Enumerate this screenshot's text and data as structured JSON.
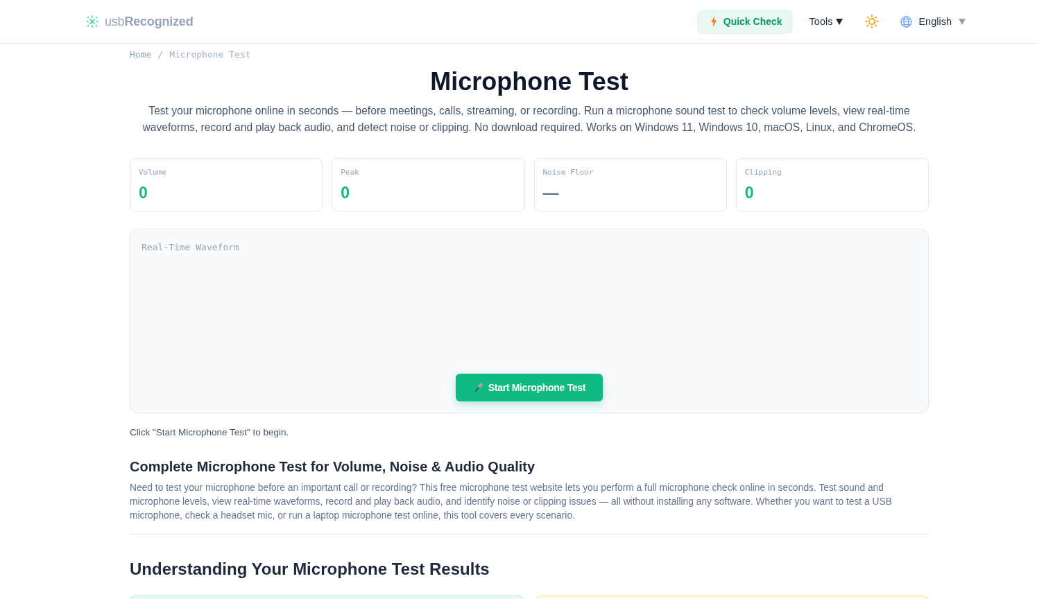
{
  "header": {
    "logo": "usb**Recognized**",
    "nav": [
      {
        "kind": "quick",
        "label": "Quick Check"
      },
      {
        "kind": "menu",
        "label": "Tools"
      },
      {
        "kind": "theme"
      },
      {
        "kind": "language",
        "label": "English"
      }
    ]
  },
  "breadcrumb": {
    "separator": "/",
    "items": [
      {
        "label": "Home",
        "current": false
      },
      {
        "label": "Microphone Test",
        "current": true
      }
    ]
  },
  "hero": {
    "title": "Microphone Test",
    "intro": "Test your microphone online in seconds — before meetings, calls, streaming, or recording. Run a microphone sound test to check volume levels, view real-time waveforms, record and play back audio, and detect noise or clipping. No download required. Works on Windows 11, Windows 10, macOS, Linux, and ChromeOS."
  },
  "stats": [
    {
      "label": "Volume",
      "value": "0",
      "kind": "number"
    },
    {
      "label": "Peak",
      "value": "0",
      "kind": "number"
    },
    {
      "label": "Noise Floor",
      "value": "—",
      "kind": "empty"
    },
    {
      "label": "Clipping",
      "value": "0",
      "kind": "number"
    }
  ],
  "waveform": {
    "label": "Real-Time Waveform",
    "button": "Start Microphone Test"
  },
  "status": "Click \"Start Microphone Test\" to begin.",
  "sections": [
    {
      "kind": "subsection",
      "heading": "Complete Microphone Test for Volume, Noise & Audio Quality",
      "text": "Need to test your microphone before an important call or recording? This free microphone test website lets you perform a full microphone check online in seconds. Test sound and microphone levels, view real-time waveforms, record and play back audio, and identify noise or clipping issues — all without installing any software. Whether you want to test a USB microphone, check a headset mic, or run a laptop microphone test online, this tool covers every scenario."
    },
    {
      "kind": "section",
      "heading": "Understanding Your Microphone Test Results",
      "cards": [
        {
          "color": "#a7f3d0"
        },
        {
          "color": "#fde68a"
        }
      ]
    }
  ]
}
